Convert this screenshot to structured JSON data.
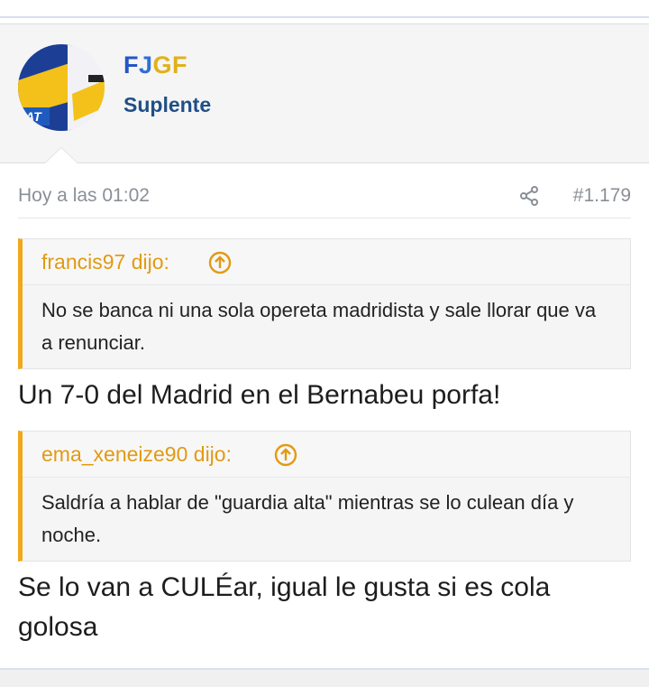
{
  "user": {
    "name_parts": [
      "F",
      "J",
      "G",
      "F"
    ],
    "title": "Suplente",
    "avatar_label": "AT"
  },
  "post": {
    "date": "Hoy a las 01:02",
    "number": "#1.179",
    "quotes": [
      {
        "author": "francis97 dijo:",
        "text": "No se banca ni una sola opereta madridista y sale llorar que va a renunciar."
      },
      {
        "author": "ema_xeneize90 dijo:",
        "text": "Saldría a hablar de \"guardia alta\" mientras se lo culean día y noche."
      }
    ],
    "replies": [
      "Un 7-0 del Madrid en el Bernabeu porfa!",
      "Se lo van a CULÉar, igual le gusta si es cola golosa"
    ]
  },
  "colors": {
    "quote_accent": "#f2a818",
    "user_title": "#1f4f86",
    "meta_text": "#8a8f96"
  },
  "icons": {
    "share": "share-icon",
    "quote_jump": "arrow-up-circle-icon"
  }
}
